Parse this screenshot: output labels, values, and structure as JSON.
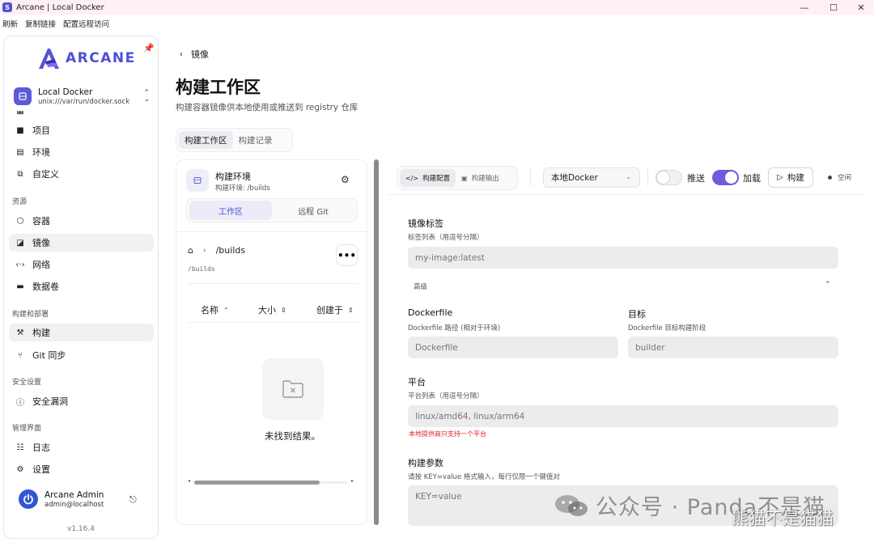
{
  "window": {
    "title": "Arcane | Local Docker",
    "controls": {
      "minimize": "—",
      "maximize": "☐",
      "close": "✕"
    }
  },
  "menubar": [
    "刷新",
    "复制链接",
    "配置远程访问"
  ],
  "sidebar": {
    "logo_text": "ARCANE",
    "environment": {
      "name": "Local Docker",
      "socket": "unix:///var/run/docker.sock"
    },
    "top_items": [
      {
        "label": "项目",
        "icon": "folder-icon"
      },
      {
        "label": "环境",
        "icon": "server-icon"
      },
      {
        "label": "自定义",
        "icon": "customize-icon"
      }
    ],
    "sections": [
      {
        "title": "资源",
        "items": [
          {
            "label": "容器",
            "icon": "container-icon"
          },
          {
            "label": "镜像",
            "icon": "image-icon",
            "active": true
          },
          {
            "label": "网络",
            "icon": "network-icon"
          },
          {
            "label": "数据卷",
            "icon": "volume-icon"
          }
        ]
      },
      {
        "title": "构建和部署",
        "items": [
          {
            "label": "构建",
            "icon": "hammer-icon",
            "active": true
          },
          {
            "label": "Git 同步",
            "icon": "git-icon"
          }
        ]
      },
      {
        "title": "安全设置",
        "items": [
          {
            "label": "安全漏洞",
            "icon": "shield-icon"
          }
        ]
      },
      {
        "title": "管理界面",
        "items": [
          {
            "label": "日志",
            "icon": "log-icon"
          },
          {
            "label": "设置",
            "icon": "gear-icon"
          }
        ]
      }
    ],
    "user": {
      "name": "Arcane Admin",
      "email": "admin@localhost"
    },
    "version": "v1.16.4"
  },
  "header": {
    "back_label": "镜像",
    "title": "构建工作区",
    "subtitle": "构建容器镜像供本地使用或推送到 registry 仓库",
    "tabs": [
      {
        "label": "构建工作区",
        "active": true
      },
      {
        "label": "构建记录",
        "active": false
      }
    ]
  },
  "left_panel": {
    "title": "构建环境",
    "subtitle": "构建环境: /builds",
    "tabs": [
      {
        "label": "工作区",
        "active": true
      },
      {
        "label": "远程 Git",
        "active": false
      }
    ],
    "breadcrumb": "/builds",
    "path_small": "/builds",
    "more_label": "•••",
    "columns": [
      "名称",
      "大小",
      "创建于"
    ],
    "empty_text": "未找到结果。"
  },
  "right_panel": {
    "tabs": [
      {
        "label": "构建配置",
        "active": true
      },
      {
        "label": "构建输出",
        "active": false
      }
    ],
    "docker_select": "本地Docker",
    "push_label": "推送",
    "push_on": false,
    "load_label": "加载",
    "load_on": true,
    "build_label": "构建",
    "status": "空闲",
    "form": {
      "image_tags": {
        "label": "镜像标签",
        "hint": "标签列表（用逗号分隔）",
        "placeholder": "my-image:latest"
      },
      "advanced": "高级",
      "dockerfile": {
        "label": "Dockerfile",
        "hint": "Dockerfile 路径 (相对于环境)",
        "placeholder": "Dockerfile"
      },
      "target": {
        "label": "目标",
        "hint": "Dockerfile 目标构建阶段",
        "placeholder": "builder"
      },
      "platform": {
        "label": "平台",
        "hint": "平台列表（用逗号分隔）",
        "placeholder": "linux/amd64, linux/arm64",
        "warning": "本地提供商只支持一个平台"
      },
      "build_args": {
        "label": "构建参数",
        "hint": "请按 KEY=value 格式输入，每行仅限一个键值对",
        "placeholder": "KEY=value"
      }
    }
  },
  "watermark": {
    "text": "公众号 · Panda不是猫",
    "overlay": "熊猫不是猫猫"
  },
  "colors": {
    "accent": "#5b5bd9",
    "toggle_on": "#6b5ce0",
    "warning": "#e0202a"
  }
}
